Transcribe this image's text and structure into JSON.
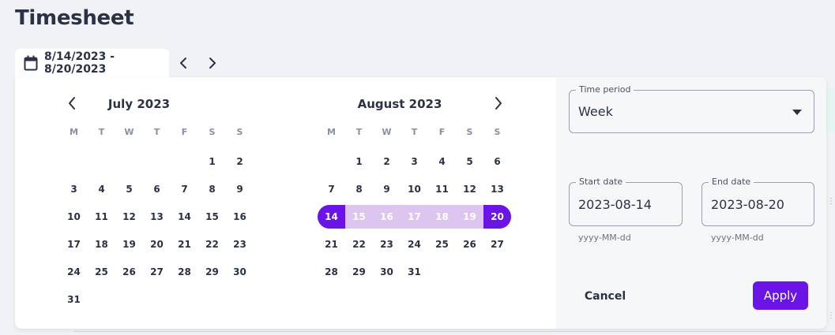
{
  "page": {
    "title": "Timesheet"
  },
  "toolbar": {
    "date_range": "8/14/2023 - 8/20/2023",
    "icons": {
      "calendar": "calendar-icon",
      "prev": "chevron-left-icon",
      "next": "chevron-right-icon"
    }
  },
  "calendar": {
    "weekdays": [
      "M",
      "T",
      "W",
      "T",
      "F",
      "S",
      "S"
    ],
    "months": [
      {
        "title": "July 2023",
        "weeks": [
          [
            "",
            "",
            "",
            "",
            "",
            "1",
            "2"
          ],
          [
            "3",
            "4",
            "5",
            "6",
            "7",
            "8",
            "9"
          ],
          [
            "10",
            "11",
            "12",
            "13",
            "14",
            "15",
            "16"
          ],
          [
            "17",
            "18",
            "19",
            "20",
            "21",
            "22",
            "23"
          ],
          [
            "24",
            "25",
            "26",
            "27",
            "28",
            "29",
            "30"
          ],
          [
            "31",
            "",
            "",
            "",
            "",
            "",
            ""
          ]
        ]
      },
      {
        "title": "August 2023",
        "weeks": [
          [
            "",
            "1",
            "2",
            "3",
            "4",
            "5",
            "6"
          ],
          [
            "7",
            "8",
            "9",
            "10",
            "11",
            "12",
            "13"
          ],
          [
            "14",
            "15",
            "16",
            "17",
            "18",
            "19",
            "20"
          ],
          [
            "21",
            "22",
            "23",
            "24",
            "25",
            "26",
            "27"
          ],
          [
            "28",
            "29",
            "30",
            "31",
            "",
            "",
            ""
          ]
        ]
      }
    ],
    "selected_range": {
      "month": "August 2023",
      "start": "14",
      "end": "20"
    },
    "colors": {
      "accent": "#6a14e8",
      "range_band": "#dcc6f0"
    }
  },
  "panel": {
    "time_period": {
      "label": "Time period",
      "value": "Week"
    },
    "start_date": {
      "label": "Start date",
      "value": "2023-08-14",
      "helper": "yyyy-MM-dd"
    },
    "end_date": {
      "label": "End date",
      "value": "2023-08-20",
      "helper": "yyyy-MM-dd"
    },
    "cancel_label": "Cancel",
    "apply_label": "Apply"
  }
}
